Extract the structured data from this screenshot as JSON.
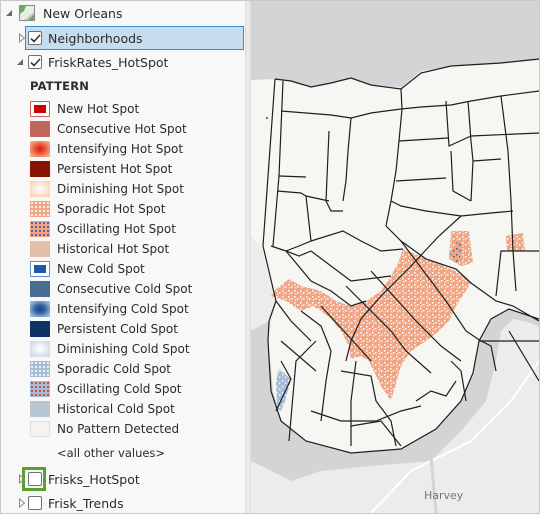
{
  "contents": {
    "map_node": {
      "label": "New Orleans",
      "icon": "map-icon",
      "expanded": true
    },
    "layers": [
      {
        "label": "Neighborhoods",
        "checked": true,
        "selected": true,
        "expanded": false
      },
      {
        "label": "FriskRates_HotSpot",
        "checked": true,
        "selected": false,
        "expanded": true
      },
      {
        "label": "Frisks_HotSpot",
        "checked": false,
        "selected": false,
        "expanded": false,
        "highlighted": true
      },
      {
        "label": "Frisk_Trends",
        "checked": false,
        "selected": false,
        "expanded": false
      }
    ],
    "legend": {
      "heading": "PATTERN",
      "items": [
        {
          "label": "New Hot Spot",
          "color": "#cc0000"
        },
        {
          "label": "Consecutive Hot Spot",
          "color": "#c0675c"
        },
        {
          "label": "Intensifying Hot Spot",
          "color": "#e0412a"
        },
        {
          "label": "Persistent Hot Spot",
          "color": "#8a1200"
        },
        {
          "label": "Diminishing Hot Spot",
          "color": "#fbd9bf"
        },
        {
          "label": "Sporadic Hot Spot",
          "color": "#f0a584"
        },
        {
          "label": "Oscillating Hot Spot",
          "color": "#f0a584"
        },
        {
          "label": "Historical Hot Spot",
          "color": "#e2bfa8"
        },
        {
          "label": "New Cold Spot",
          "color": "#1a5aa8"
        },
        {
          "label": "Consecutive Cold Spot",
          "color": "#4a6d96"
        },
        {
          "label": "Intensifying Cold Spot",
          "color": "#2e5e9e"
        },
        {
          "label": "Persistent Cold Spot",
          "color": "#0f3366"
        },
        {
          "label": "Diminishing Cold Spot",
          "color": "#d5dfe8"
        },
        {
          "label": "Sporadic Cold Spot",
          "color": "#a8bcd8"
        },
        {
          "label": "Oscillating Cold Spot",
          "color": "#a8bcd8"
        },
        {
          "label": "Historical Cold Spot",
          "color": "#b8c6d2"
        },
        {
          "label": "No Pattern Detected",
          "color": "#f4f4ef"
        }
      ],
      "other_values_label": "<all other values>"
    }
  },
  "map": {
    "place_label": "Harvey",
    "colors": {
      "water": "#d2d4d6",
      "land": "#ececec",
      "neighborhood_fill": "#f6f6f2",
      "boundary": "#1e1e1e",
      "hot_fill": "#f0a584",
      "cold_fill": "#a8bcd8"
    }
  }
}
